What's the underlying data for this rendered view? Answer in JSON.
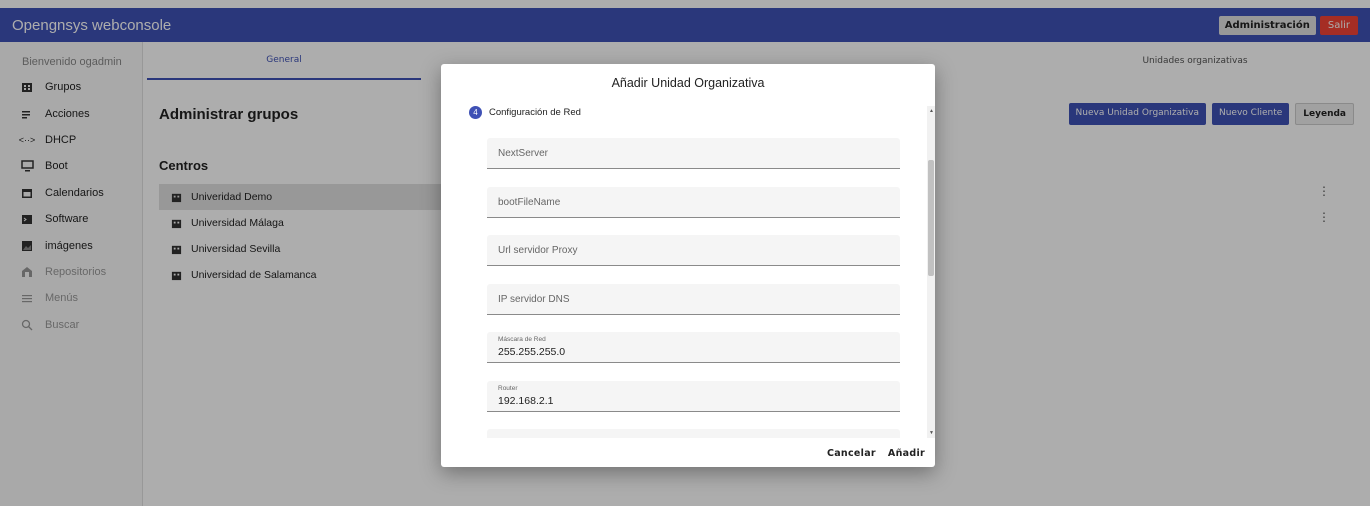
{
  "app": {
    "title": "Opengnsys webconsole"
  },
  "header": {
    "admin_label": "Administración",
    "exit_label": "Salir"
  },
  "sidebar": {
    "welcome": "Bienvenido ogadmin",
    "items": [
      {
        "label": "Grupos",
        "icon": "building-icon",
        "disabled": false
      },
      {
        "label": "Acciones",
        "icon": "list-icon",
        "disabled": false
      },
      {
        "label": "DHCP",
        "icon": "code-icon",
        "disabled": false
      },
      {
        "label": "Boot",
        "icon": "monitor-icon",
        "disabled": false
      },
      {
        "label": "Calendarios",
        "icon": "calendar-icon",
        "disabled": false
      },
      {
        "label": "Software",
        "icon": "terminal-icon",
        "disabled": false
      },
      {
        "label": "imágenes",
        "icon": "image-icon",
        "disabled": false
      },
      {
        "label": "Repositorios",
        "icon": "storage-icon",
        "disabled": true
      },
      {
        "label": "Menús",
        "icon": "menu-icon",
        "disabled": true
      },
      {
        "label": "Buscar",
        "icon": "search-icon",
        "disabled": true
      }
    ]
  },
  "main": {
    "tabs": [
      {
        "label": "General"
      },
      {
        "label": "Unidades organizativas"
      }
    ],
    "page_title": "Administrar grupos",
    "actions": {
      "new_unit": "Nueva Unidad Organizativa",
      "new_client": "Nuevo Cliente",
      "legend": "Leyenda"
    },
    "centros_title": "Centros",
    "centros": [
      {
        "label": "Univeridad Demo"
      },
      {
        "label": "Universidad Málaga"
      },
      {
        "label": "Universidad Sevilla"
      },
      {
        "label": "Universidad de Salamanca"
      }
    ]
  },
  "dialog": {
    "title": "Añadir Unidad Organizativa",
    "step_number": "4",
    "step_label": "Configuración de Red",
    "fields": [
      {
        "placeholder": "NextServer",
        "label": "",
        "value": ""
      },
      {
        "placeholder": "bootFileName",
        "label": "",
        "value": ""
      },
      {
        "placeholder": "Url servidor Proxy",
        "label": "",
        "value": ""
      },
      {
        "placeholder": "IP servidor DNS",
        "label": "",
        "value": ""
      },
      {
        "placeholder": "",
        "label": "Máscara de Red",
        "value": "255.255.255.0"
      },
      {
        "placeholder": "",
        "label": "Router",
        "value": "192.168.2.1"
      }
    ],
    "cancel_label": "Cancelar",
    "add_label": "Añadir"
  },
  "colors": {
    "primary": "#3f51b5",
    "danger": "#f44336"
  }
}
